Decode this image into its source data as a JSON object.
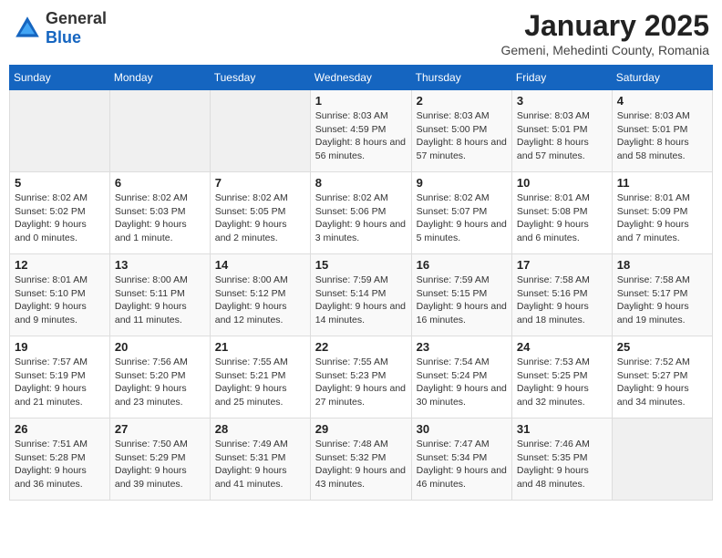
{
  "logo": {
    "text_general": "General",
    "text_blue": "Blue"
  },
  "title": "January 2025",
  "subtitle": "Gemeni, Mehedinti County, Romania",
  "weekdays": [
    "Sunday",
    "Monday",
    "Tuesday",
    "Wednesday",
    "Thursday",
    "Friday",
    "Saturday"
  ],
  "weeks": [
    [
      {
        "day": "",
        "detail": ""
      },
      {
        "day": "",
        "detail": ""
      },
      {
        "day": "",
        "detail": ""
      },
      {
        "day": "1",
        "detail": "Sunrise: 8:03 AM\nSunset: 4:59 PM\nDaylight: 8 hours and 56 minutes."
      },
      {
        "day": "2",
        "detail": "Sunrise: 8:03 AM\nSunset: 5:00 PM\nDaylight: 8 hours and 57 minutes."
      },
      {
        "day": "3",
        "detail": "Sunrise: 8:03 AM\nSunset: 5:01 PM\nDaylight: 8 hours and 57 minutes."
      },
      {
        "day": "4",
        "detail": "Sunrise: 8:03 AM\nSunset: 5:01 PM\nDaylight: 8 hours and 58 minutes."
      }
    ],
    [
      {
        "day": "5",
        "detail": "Sunrise: 8:02 AM\nSunset: 5:02 PM\nDaylight: 9 hours and 0 minutes."
      },
      {
        "day": "6",
        "detail": "Sunrise: 8:02 AM\nSunset: 5:03 PM\nDaylight: 9 hours and 1 minute."
      },
      {
        "day": "7",
        "detail": "Sunrise: 8:02 AM\nSunset: 5:05 PM\nDaylight: 9 hours and 2 minutes."
      },
      {
        "day": "8",
        "detail": "Sunrise: 8:02 AM\nSunset: 5:06 PM\nDaylight: 9 hours and 3 minutes."
      },
      {
        "day": "9",
        "detail": "Sunrise: 8:02 AM\nSunset: 5:07 PM\nDaylight: 9 hours and 5 minutes."
      },
      {
        "day": "10",
        "detail": "Sunrise: 8:01 AM\nSunset: 5:08 PM\nDaylight: 9 hours and 6 minutes."
      },
      {
        "day": "11",
        "detail": "Sunrise: 8:01 AM\nSunset: 5:09 PM\nDaylight: 9 hours and 7 minutes."
      }
    ],
    [
      {
        "day": "12",
        "detail": "Sunrise: 8:01 AM\nSunset: 5:10 PM\nDaylight: 9 hours and 9 minutes."
      },
      {
        "day": "13",
        "detail": "Sunrise: 8:00 AM\nSunset: 5:11 PM\nDaylight: 9 hours and 11 minutes."
      },
      {
        "day": "14",
        "detail": "Sunrise: 8:00 AM\nSunset: 5:12 PM\nDaylight: 9 hours and 12 minutes."
      },
      {
        "day": "15",
        "detail": "Sunrise: 7:59 AM\nSunset: 5:14 PM\nDaylight: 9 hours and 14 minutes."
      },
      {
        "day": "16",
        "detail": "Sunrise: 7:59 AM\nSunset: 5:15 PM\nDaylight: 9 hours and 16 minutes."
      },
      {
        "day": "17",
        "detail": "Sunrise: 7:58 AM\nSunset: 5:16 PM\nDaylight: 9 hours and 18 minutes."
      },
      {
        "day": "18",
        "detail": "Sunrise: 7:58 AM\nSunset: 5:17 PM\nDaylight: 9 hours and 19 minutes."
      }
    ],
    [
      {
        "day": "19",
        "detail": "Sunrise: 7:57 AM\nSunset: 5:19 PM\nDaylight: 9 hours and 21 minutes."
      },
      {
        "day": "20",
        "detail": "Sunrise: 7:56 AM\nSunset: 5:20 PM\nDaylight: 9 hours and 23 minutes."
      },
      {
        "day": "21",
        "detail": "Sunrise: 7:55 AM\nSunset: 5:21 PM\nDaylight: 9 hours and 25 minutes."
      },
      {
        "day": "22",
        "detail": "Sunrise: 7:55 AM\nSunset: 5:23 PM\nDaylight: 9 hours and 27 minutes."
      },
      {
        "day": "23",
        "detail": "Sunrise: 7:54 AM\nSunset: 5:24 PM\nDaylight: 9 hours and 30 minutes."
      },
      {
        "day": "24",
        "detail": "Sunrise: 7:53 AM\nSunset: 5:25 PM\nDaylight: 9 hours and 32 minutes."
      },
      {
        "day": "25",
        "detail": "Sunrise: 7:52 AM\nSunset: 5:27 PM\nDaylight: 9 hours and 34 minutes."
      }
    ],
    [
      {
        "day": "26",
        "detail": "Sunrise: 7:51 AM\nSunset: 5:28 PM\nDaylight: 9 hours and 36 minutes."
      },
      {
        "day": "27",
        "detail": "Sunrise: 7:50 AM\nSunset: 5:29 PM\nDaylight: 9 hours and 39 minutes."
      },
      {
        "day": "28",
        "detail": "Sunrise: 7:49 AM\nSunset: 5:31 PM\nDaylight: 9 hours and 41 minutes."
      },
      {
        "day": "29",
        "detail": "Sunrise: 7:48 AM\nSunset: 5:32 PM\nDaylight: 9 hours and 43 minutes."
      },
      {
        "day": "30",
        "detail": "Sunrise: 7:47 AM\nSunset: 5:34 PM\nDaylight: 9 hours and 46 minutes."
      },
      {
        "day": "31",
        "detail": "Sunrise: 7:46 AM\nSunset: 5:35 PM\nDaylight: 9 hours and 48 minutes."
      },
      {
        "day": "",
        "detail": ""
      }
    ]
  ]
}
